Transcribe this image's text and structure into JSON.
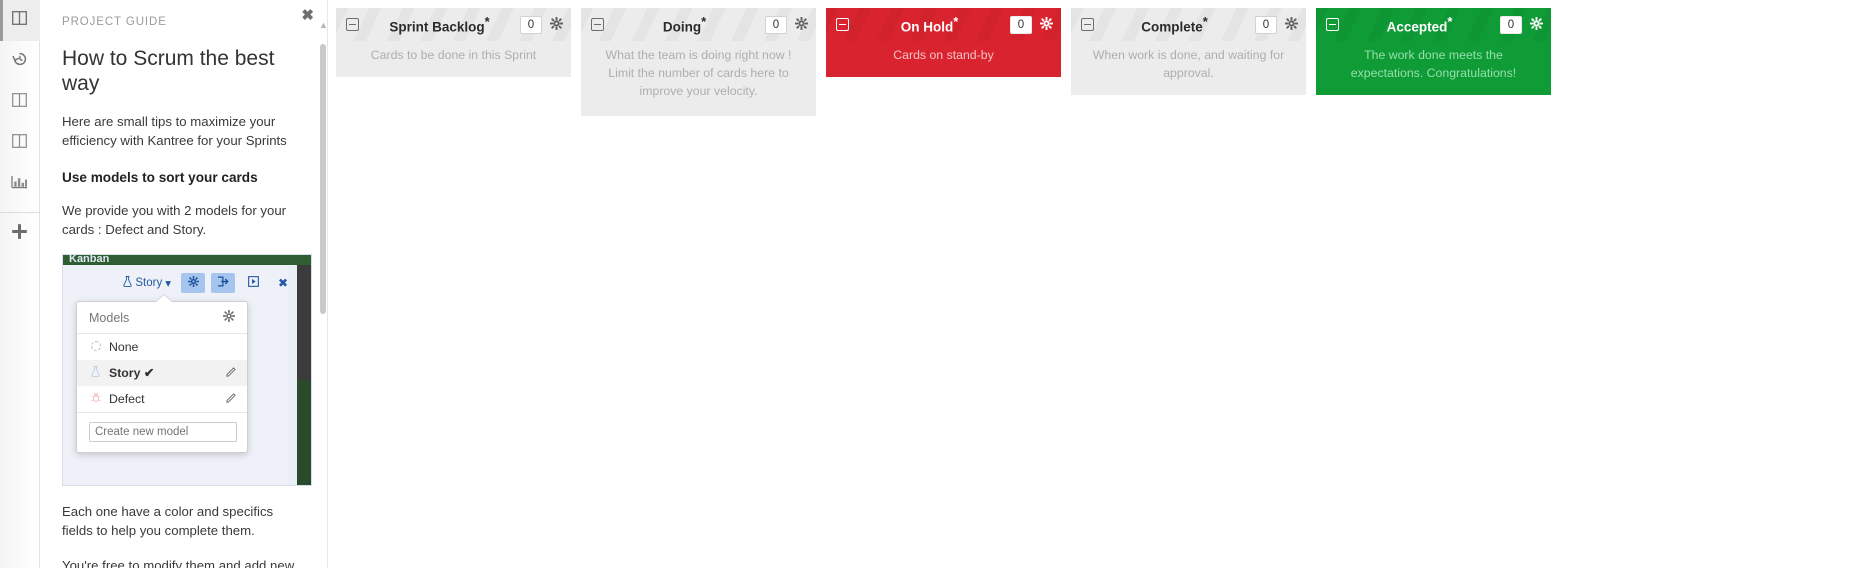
{
  "rail": {
    "items": [
      {
        "name": "board-view",
        "icon": "columns-icon",
        "active": true
      },
      {
        "name": "history-view",
        "icon": "history-icon",
        "active": false
      },
      {
        "name": "list-view",
        "icon": "columns-icon",
        "active": false
      },
      {
        "name": "table-view",
        "icon": "columns-icon",
        "active": false
      },
      {
        "name": "reports-view",
        "icon": "bar-chart-icon",
        "active": false
      }
    ],
    "add_label": "+"
  },
  "guide": {
    "eyebrow": "PROJECT GUIDE",
    "close_label": "✖",
    "title": "How to Scrum the best way",
    "intro": "Here are small tips to maximize your efficiency with Kantree for your Sprints",
    "section_heading": "Use models to sort your cards",
    "section_body": "We provide you with 2 models for your cards : Defect and Story.",
    "after_body_1": "Each one have a color and specifics fields to help you complete them.",
    "after_body_2": "You're free to modify them and add new.",
    "screenshot": {
      "kanban_label": "Kanban",
      "story_selector": "Story",
      "popover": {
        "title": "Models",
        "gear_icon": "gear-icon",
        "rows": [
          {
            "label": "None",
            "icon": "dashed-circle-icon",
            "selected": false,
            "editable": false,
            "check": ""
          },
          {
            "label": "Story",
            "icon": "flask-icon",
            "selected": true,
            "editable": true,
            "check": "✔"
          },
          {
            "label": "Defect",
            "icon": "bug-icon",
            "selected": false,
            "editable": true,
            "check": ""
          }
        ],
        "input_placeholder": "Create new model"
      }
    }
  },
  "board": {
    "columns": [
      {
        "name": "sprint-backlog",
        "title": "Sprint Backlog",
        "marker": "*",
        "count": "0",
        "description": "Cards to be done in this Sprint",
        "style": "grey"
      },
      {
        "name": "doing",
        "title": "Doing",
        "marker": "*",
        "count": "0",
        "description": "What the team is doing right now ! Limit the number of cards here to improve your velocity.",
        "style": "grey"
      },
      {
        "name": "on-hold",
        "title": "On Hold",
        "marker": "*",
        "count": "0",
        "description": "Cards on stand-by",
        "style": "red"
      },
      {
        "name": "complete",
        "title": "Complete",
        "marker": "*",
        "count": "0",
        "description": "When work is done, and waiting for approval.",
        "style": "grey"
      },
      {
        "name": "accepted",
        "title": "Accepted",
        "marker": "*",
        "count": "0",
        "description": "The work done meets the expectations. Congratulations!",
        "style": "green"
      }
    ]
  },
  "colors": {
    "red": "#d9232e",
    "green": "#0f9c36",
    "grey": "#ececec",
    "accent_blue": "#2558a6"
  }
}
